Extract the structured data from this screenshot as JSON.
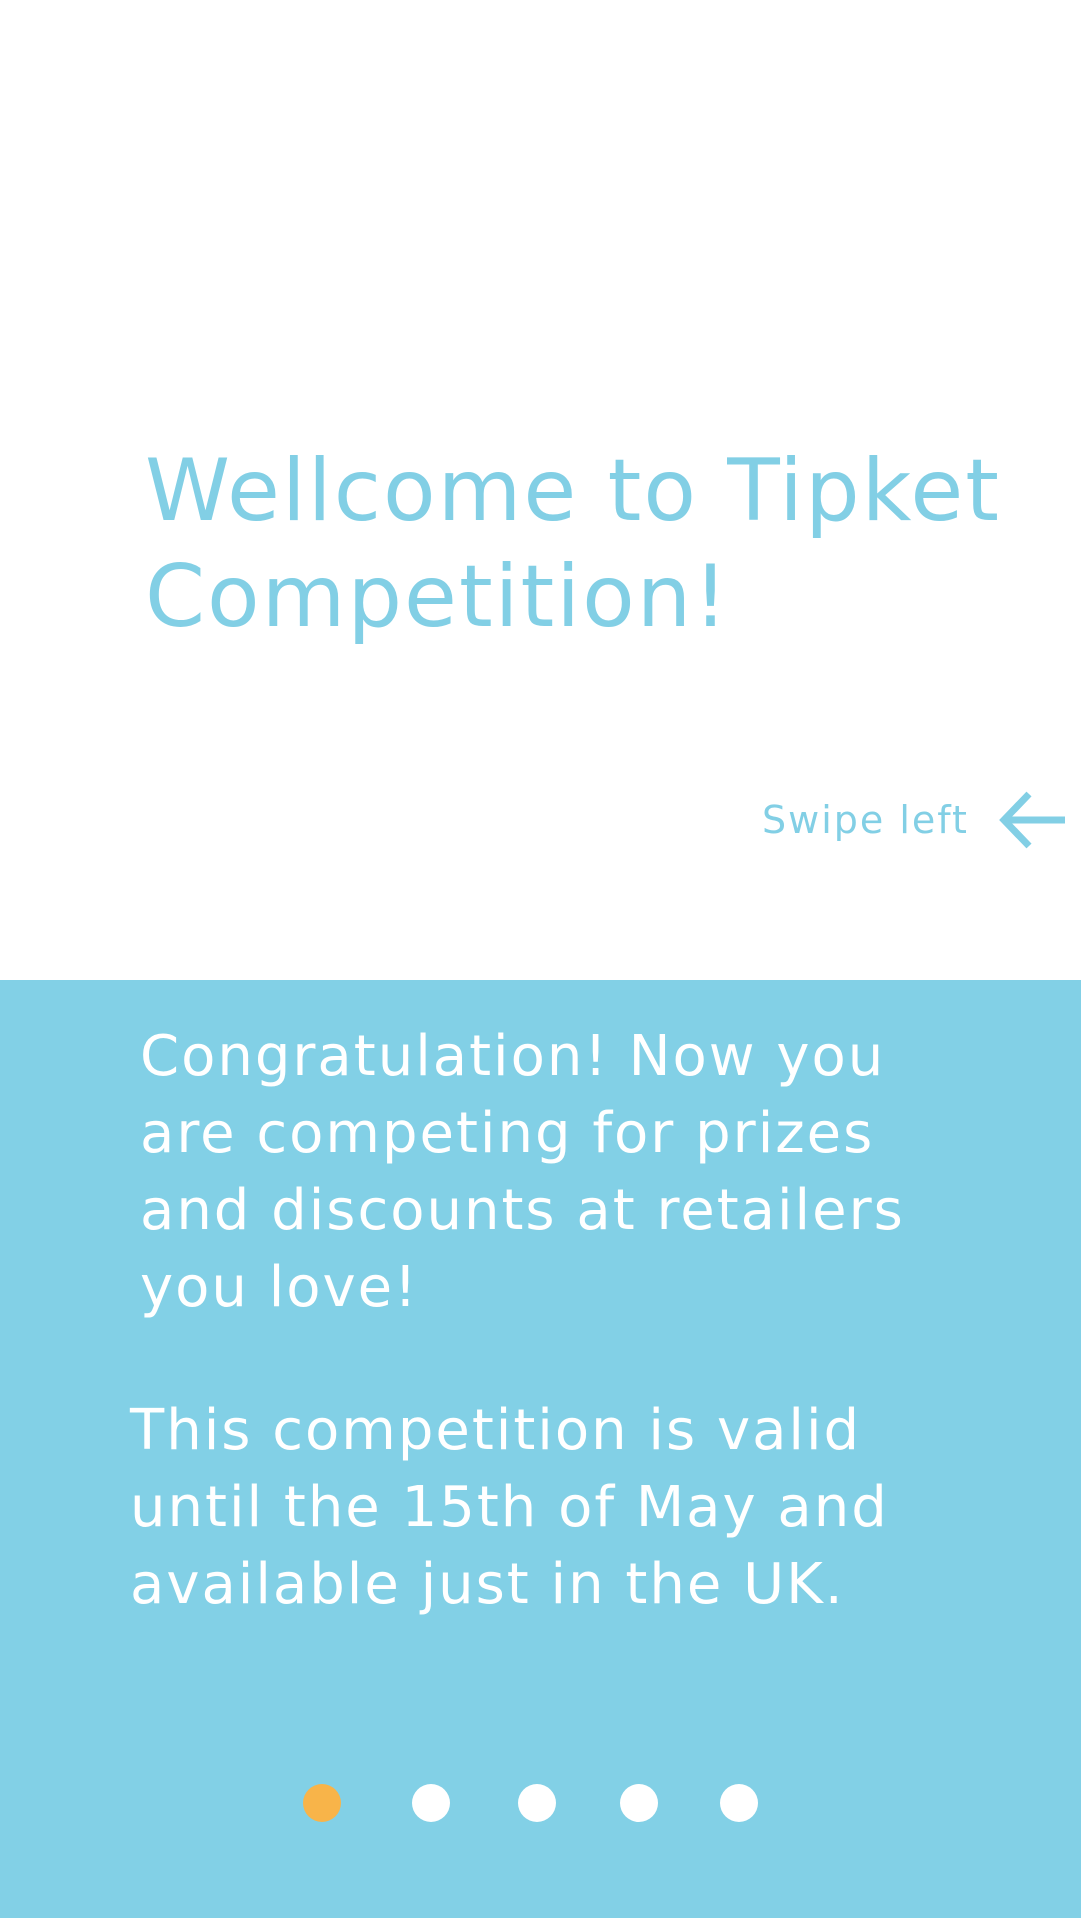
{
  "welcome": {
    "title_line1": "Wellcome to Tipket",
    "title_line2": "Competition!"
  },
  "swipe_hint": {
    "label": "Swipe left",
    "icon": "arrow-left-icon"
  },
  "info": {
    "congrats_text": "Congratulation! Now you are competing for prizes and discounts at retailers you love!",
    "validity_text": "This competition is valid until the 15th of May and available just in the UK."
  },
  "pager": {
    "total_pages": 5,
    "current_page": 1
  },
  "colors": {
    "brand_blue": "#82cfe5",
    "panel_blue": "#82d0e6",
    "active_dot": "#f8b449",
    "inactive_dot": "#ffffff",
    "background": "#ffffff"
  }
}
